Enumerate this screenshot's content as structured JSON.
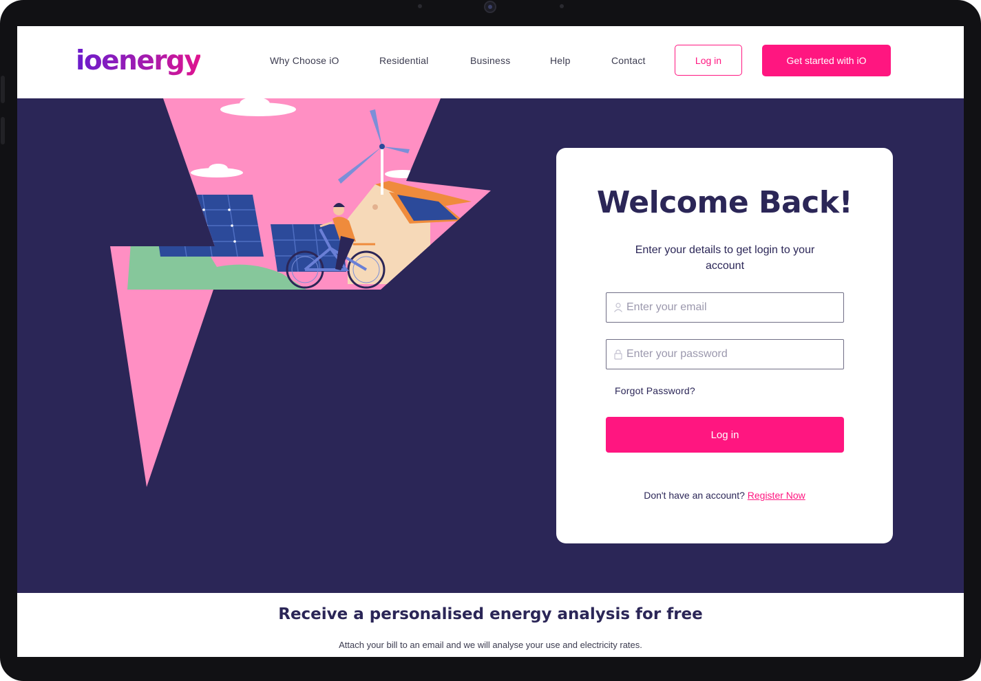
{
  "brand": {
    "logo": "ioenergy"
  },
  "nav": {
    "links": [
      "Why Choose iO",
      "Residential",
      "Business",
      "Help",
      "Contact"
    ],
    "login_label": "Log in",
    "cta_label": "Get started with iO"
  },
  "login_card": {
    "title": "Welcome Back!",
    "subtitle": "Enter your details to get login to your account",
    "email_placeholder": "Enter your email",
    "password_placeholder": "Enter your password",
    "forgot_label": "Forgot Password?",
    "submit_label": "Log in",
    "register_prompt": "Don't have an account?",
    "register_label": "Register Now"
  },
  "promo": {
    "title": "Receive a personalised energy analysis for free",
    "subtitle": "Attach your bill to an email and we will analyse your use and electricity rates."
  },
  "colors": {
    "accent": "#ff1680",
    "hero_bg": "#2b2657",
    "bolt_pink": "#ff8fc3",
    "text_dark": "#2b2657"
  },
  "icons": {
    "email_field": "user-icon",
    "password_field": "lock-icon"
  }
}
